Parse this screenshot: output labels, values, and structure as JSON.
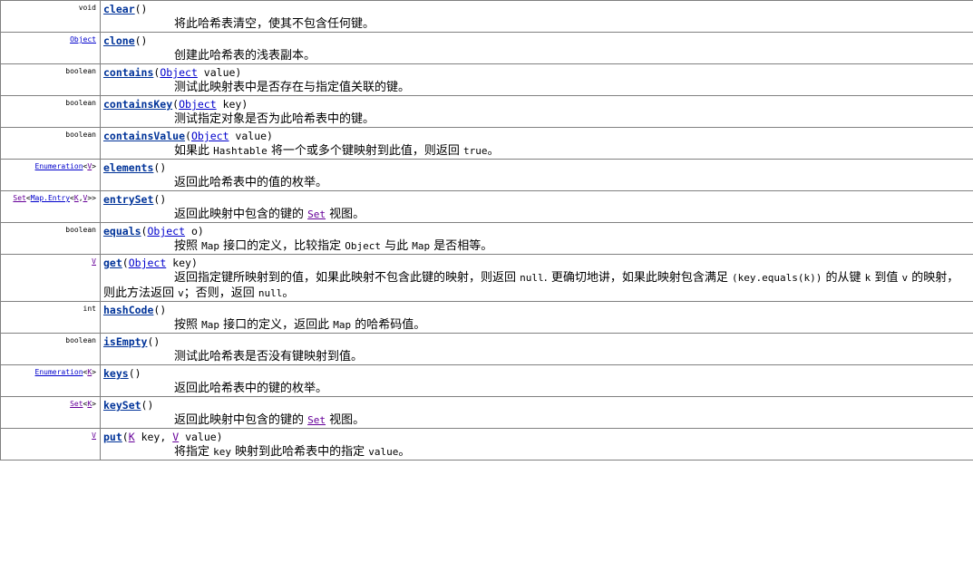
{
  "rows": [
    {
      "id": "clear",
      "type": [
        {
          "t": "void"
        }
      ],
      "method": "clear",
      "params": [
        {
          "t": "()"
        }
      ],
      "desc": [
        {
          "t": "将此哈希表清空，使其不包含任何键。"
        }
      ]
    },
    {
      "id": "clone",
      "type": [
        {
          "t": "Object",
          "link": true
        }
      ],
      "method": "clone",
      "params": [
        {
          "t": "()"
        }
      ],
      "desc": [
        {
          "t": "创建此哈希表的浅表副本。"
        }
      ]
    },
    {
      "id": "contains",
      "type": [
        {
          "t": "boolean"
        }
      ],
      "method": "contains",
      "params": [
        {
          "t": "("
        },
        {
          "t": "Object",
          "link": true
        },
        {
          "t": " value)"
        }
      ],
      "desc": [
        {
          "t": "测试此映射表中是否存在与指定值关联的键。"
        }
      ]
    },
    {
      "id": "containsKey",
      "type": [
        {
          "t": "boolean"
        }
      ],
      "method": "containsKey",
      "params": [
        {
          "t": "("
        },
        {
          "t": "Object",
          "link": true
        },
        {
          "t": " key)"
        }
      ],
      "desc": [
        {
          "t": "测试指定对象是否为此哈希表中的键。"
        }
      ]
    },
    {
      "id": "containsValue",
      "type": [
        {
          "t": "boolean"
        }
      ],
      "method": "containsValue",
      "params": [
        {
          "t": "("
        },
        {
          "t": "Object",
          "link": true
        },
        {
          "t": " value)"
        }
      ],
      "desc": [
        {
          "t": "如果此 "
        },
        {
          "t": "Hashtable",
          "code": true
        },
        {
          "t": " 将一个或多个键映射到此值，则返回 "
        },
        {
          "t": "true",
          "code": true
        },
        {
          "t": "。"
        }
      ]
    },
    {
      "id": "elements",
      "type": [
        {
          "t": "Enumeration",
          "link": true
        },
        {
          "t": "<"
        },
        {
          "t": "V",
          "link": true,
          "visited": true
        },
        {
          "t": ">"
        }
      ],
      "method": "elements",
      "params": [
        {
          "t": "()"
        }
      ],
      "desc": [
        {
          "t": "返回此哈希表中的值的枚举。"
        }
      ]
    },
    {
      "id": "entrySet",
      "type": [
        {
          "t": "Set",
          "link": true,
          "visited": true
        },
        {
          "t": "<"
        },
        {
          "t": "Map.Entry",
          "link": true
        },
        {
          "t": "<"
        },
        {
          "t": "K",
          "link": true,
          "visited": true
        },
        {
          "t": ","
        },
        {
          "t": "V",
          "link": true,
          "visited": true
        },
        {
          "t": ">>"
        }
      ],
      "method": "entrySet",
      "params": [
        {
          "t": "()"
        }
      ],
      "desc": [
        {
          "t": "返回此映射中包含的键的 "
        },
        {
          "t": "Set",
          "code": true,
          "link": true
        },
        {
          "t": " 视图。"
        }
      ]
    },
    {
      "id": "equals",
      "type": [
        {
          "t": "boolean"
        }
      ],
      "method": "equals",
      "params": [
        {
          "t": "("
        },
        {
          "t": "Object",
          "link": true
        },
        {
          "t": " o)"
        }
      ],
      "desc": [
        {
          "t": "按照 "
        },
        {
          "t": "Map",
          "code": true
        },
        {
          "t": " 接口的定义，比较指定 "
        },
        {
          "t": "Object",
          "code": true
        },
        {
          "t": " 与此 "
        },
        {
          "t": "Map",
          "code": true
        },
        {
          "t": " 是否相等。"
        }
      ]
    },
    {
      "id": "get",
      "type": [
        {
          "t": "V",
          "link": true,
          "visited": true
        }
      ],
      "method": "get",
      "params": [
        {
          "t": "("
        },
        {
          "t": "Object",
          "link": true
        },
        {
          "t": " key)"
        }
      ],
      "wrap": true,
      "desc": [
        {
          "t": "返回指定键所映射到的值，如果此映射不包含此键的映射，则返回 "
        },
        {
          "t": "null",
          "code": true
        },
        {
          "t": ". 更确切地讲，如果此映射包含满足 "
        },
        {
          "t": "(key.equals(k))",
          "code": true
        },
        {
          "t": " 的从键 "
        },
        {
          "t": "k",
          "code": true
        },
        {
          "t": " 到值 "
        },
        {
          "t": "v",
          "code": true
        },
        {
          "t": " 的映射，则此方法返回 "
        },
        {
          "t": "v",
          "code": true
        },
        {
          "t": "；否则，返回 "
        },
        {
          "t": "null",
          "code": true
        },
        {
          "t": "。"
        }
      ]
    },
    {
      "id": "hashCode",
      "type": [
        {
          "t": "int"
        }
      ],
      "method": "hashCode",
      "params": [
        {
          "t": "()"
        }
      ],
      "desc": [
        {
          "t": "按照 "
        },
        {
          "t": "Map",
          "code": true
        },
        {
          "t": " 接口的定义，返回此 "
        },
        {
          "t": "Map",
          "code": true
        },
        {
          "t": " 的哈希码值。"
        }
      ]
    },
    {
      "id": "isEmpty",
      "type": [
        {
          "t": "boolean"
        }
      ],
      "method": "isEmpty",
      "params": [
        {
          "t": "()"
        }
      ],
      "desc": [
        {
          "t": "测试此哈希表是否没有键映射到值。"
        }
      ]
    },
    {
      "id": "keys",
      "type": [
        {
          "t": "Enumeration",
          "link": true
        },
        {
          "t": "<"
        },
        {
          "t": "K",
          "link": true,
          "visited": true
        },
        {
          "t": ">"
        }
      ],
      "method": "keys",
      "params": [
        {
          "t": "()"
        }
      ],
      "desc": [
        {
          "t": "返回此哈希表中的键的枚举。"
        }
      ]
    },
    {
      "id": "keySet",
      "type": [
        {
          "t": "Set",
          "link": true,
          "visited": true
        },
        {
          "t": "<"
        },
        {
          "t": "K",
          "link": true,
          "visited": true
        },
        {
          "t": ">"
        }
      ],
      "method": "keySet",
      "params": [
        {
          "t": "()"
        }
      ],
      "desc": [
        {
          "t": "返回此映射中包含的键的 "
        },
        {
          "t": "Set",
          "code": true,
          "link": true
        },
        {
          "t": " 视图。"
        }
      ]
    },
    {
      "id": "put",
      "type": [
        {
          "t": "V",
          "link": true,
          "visited": true
        }
      ],
      "method": "put",
      "params": [
        {
          "t": "("
        },
        {
          "t": "K",
          "link": true,
          "visited": true
        },
        {
          "t": " key, "
        },
        {
          "t": "V",
          "link": true,
          "visited": true
        },
        {
          "t": " value)"
        }
      ],
      "desc": [
        {
          "t": "将指定 "
        },
        {
          "t": "key",
          "code": true
        },
        {
          "t": " 映射到此哈希表中的指定 "
        },
        {
          "t": "value",
          "code": true
        },
        {
          "t": "。"
        }
      ]
    }
  ]
}
